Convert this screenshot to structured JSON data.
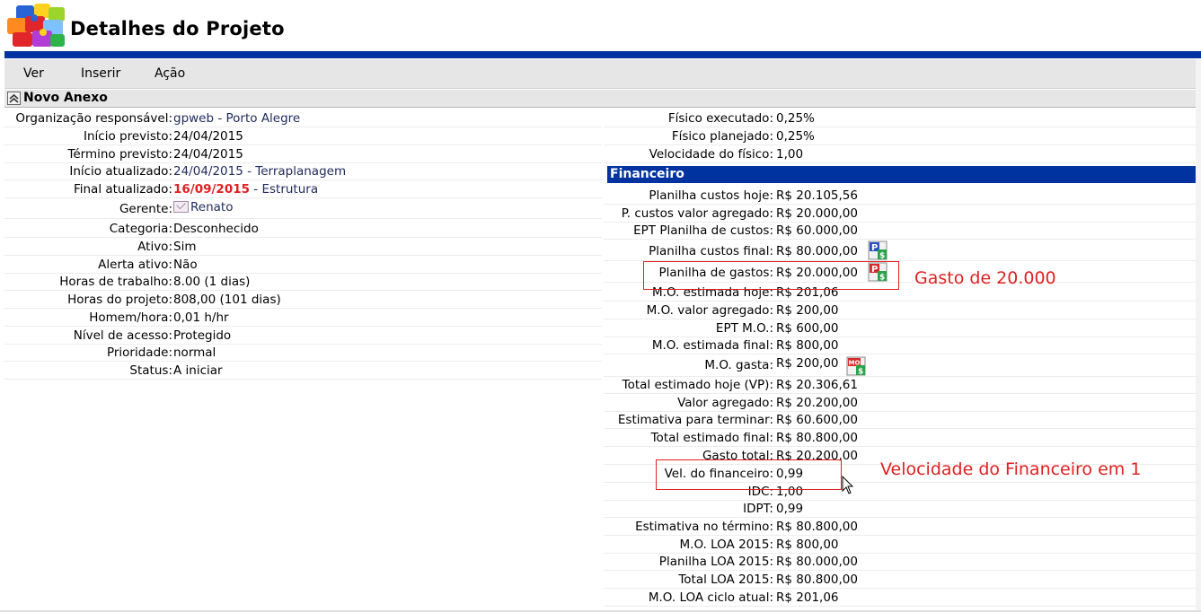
{
  "header": {
    "title": "Detalhes do Projeto",
    "logo_icon": "puzzle-logo-icon"
  },
  "menu": {
    "items": [
      {
        "label": "Ver"
      },
      {
        "label": "Inserir"
      },
      {
        "label": "Ação"
      }
    ]
  },
  "section": {
    "title": "Novo Anexo",
    "toggle_icon": "double-chevron-up-icon"
  },
  "project": {
    "rows": [
      {
        "label": "Organização responsável:",
        "value": "gpweb - Porto Alegre"
      },
      {
        "label": "Início previsto:",
        "value": "24/04/2015"
      },
      {
        "label": "Término previsto:",
        "value": "24/04/2015"
      },
      {
        "label": "Início atualizado:",
        "value": "24/04/2015 - Terraplanagem"
      },
      {
        "label": "Final atualizado:",
        "value_date": "16/09/2015",
        "value_rest": " - Estrutura"
      },
      {
        "label": "Gerente:",
        "value": "Renato"
      },
      {
        "label": "Categoria:",
        "value": "Desconhecido"
      },
      {
        "label": "Ativo:",
        "value": "Sim"
      },
      {
        "label": "Alerta ativo:",
        "value": "Não"
      },
      {
        "label": "Horas de trabalho:",
        "value": "8.00 (1 dias)"
      },
      {
        "label": "Horas do projeto:",
        "value": "808,00 (101 dias)"
      },
      {
        "label": "Homem/hora:",
        "value": "0,01 h/hr"
      },
      {
        "label": "Nível de acesso:",
        "value": "Protegido"
      },
      {
        "label": "Prioridade:",
        "value": "normal"
      },
      {
        "label": "Status:",
        "value": "A iniciar"
      }
    ]
  },
  "physical": {
    "rows": [
      {
        "label": "Físico executado:",
        "value": "0,25%"
      },
      {
        "label": "Físico planejado:",
        "value": "0,25%"
      },
      {
        "label": "Velocidade do físico:",
        "value": "1,00"
      }
    ]
  },
  "financial": {
    "title": "Financeiro",
    "rows": [
      {
        "label": "Planilha custos hoje:",
        "value": "R$ 20.105,56"
      },
      {
        "label": "P. custos valor agregado:",
        "value": "R$ 20.000,00"
      },
      {
        "label": "EPT Planilha de custos:",
        "value": "R$ 60.000,00"
      },
      {
        "label": "Planilha custos final:",
        "value": "R$ 80.000,00"
      },
      {
        "label": "Planilha de gastos:",
        "value": "R$ 20.000,00"
      },
      {
        "label": "M.O. estimada hoje:",
        "value": "R$ 201,06"
      },
      {
        "label": "M.O. valor agregado:",
        "value": "R$ 200,00"
      },
      {
        "label": "EPT M.O.:",
        "value": "R$ 600,00"
      },
      {
        "label": "M.O. estimada final:",
        "value": "R$ 800,00"
      },
      {
        "label": "M.O. gasta:",
        "value": "R$ 200,00"
      },
      {
        "label": "Total estimado hoje (VP):",
        "value": "R$ 20.306,61"
      },
      {
        "label": "Valor agregado:",
        "value": "R$ 20.200,00"
      },
      {
        "label": "Estimativa para terminar:",
        "value": "R$ 60.600,00"
      },
      {
        "label": "Total estimado final:",
        "value": "R$ 80.800,00"
      },
      {
        "label": "Gasto total:",
        "value": "R$ 20.200,00"
      },
      {
        "label": "Vel. do financeiro:",
        "value": "0,99"
      },
      {
        "label": "IDC:",
        "value": "1,00"
      },
      {
        "label": "IDPT:",
        "value": "0,99"
      },
      {
        "label": "Estimativa no término:",
        "value": "R$ 80.800,00"
      },
      {
        "label": "M.O. LOA 2015:",
        "value": "R$ 800,00"
      },
      {
        "label": "Planilha LOA 2015:",
        "value": "R$ 80.000,00"
      },
      {
        "label": "Total LOA 2015:",
        "value": "R$ 80.800,00"
      },
      {
        "label": "M.O. LOA ciclo atual:",
        "value": "R$ 201,06"
      }
    ]
  },
  "annotations": {
    "gasto": "Gasto de 20.000",
    "velocidade": "Velocidade do Financeiro em 1"
  },
  "colors": {
    "accent_blue": "#0033a0",
    "annotation_red": "#e02020",
    "date_red": "#e02020",
    "link_navy": "#1f2a5c"
  }
}
